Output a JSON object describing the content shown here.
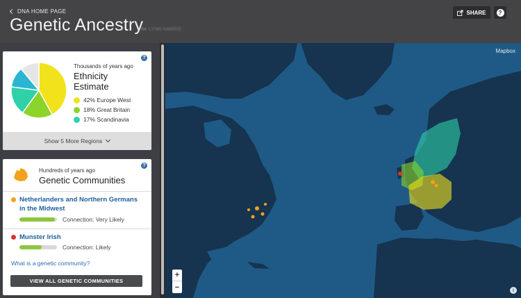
{
  "header": {
    "back_label": "DNA HOME PAGE",
    "title": "Genetic Ancestry",
    "subtitle_prefix": "for",
    "subtitle_name": "LYNN HARRIS",
    "share_label": "SHARE",
    "help_label": "?"
  },
  "ethnicity": {
    "kicker": "Thousands of years ago",
    "title": "Ethnicity Estimate",
    "regions": [
      {
        "percent": 42,
        "label": "42% Europe West",
        "color": "#f2e21c"
      },
      {
        "percent": 18,
        "label": "18% Great Britain",
        "color": "#8cd42a"
      },
      {
        "percent": 17,
        "label": "17% Scandinavia",
        "color": "#2fd1a8"
      }
    ],
    "other_slices": [
      {
        "percent": 12,
        "color": "#2ab5d2"
      },
      {
        "percent": 11,
        "color": "#e6e6e6"
      }
    ],
    "show_more_label": "Show 5 More Regions"
  },
  "communities": {
    "kicker": "Hundreds of years ago",
    "title": "Genetic Communities",
    "items": [
      {
        "name": "Netherlanders and Northern Germans in the Midwest",
        "connection": "Connection: Very Likely",
        "strength": 0.95,
        "color": "#f2a21c"
      },
      {
        "name": "Munster Irish",
        "connection": "Connection: Likely",
        "strength": 0.6,
        "color": "#d9342b"
      }
    ],
    "what_link": "What is a genetic community?",
    "view_all_label": "VIEW ALL GENETIC COMMUNITIES"
  },
  "map": {
    "attribution": "Mapbox",
    "zoom_in": "+",
    "zoom_out": "−",
    "info": "i"
  },
  "colors": {
    "header_bg": "#444446",
    "map_water": "#1f5a86",
    "map_land": "#15304c",
    "link": "#1d5f9e"
  }
}
